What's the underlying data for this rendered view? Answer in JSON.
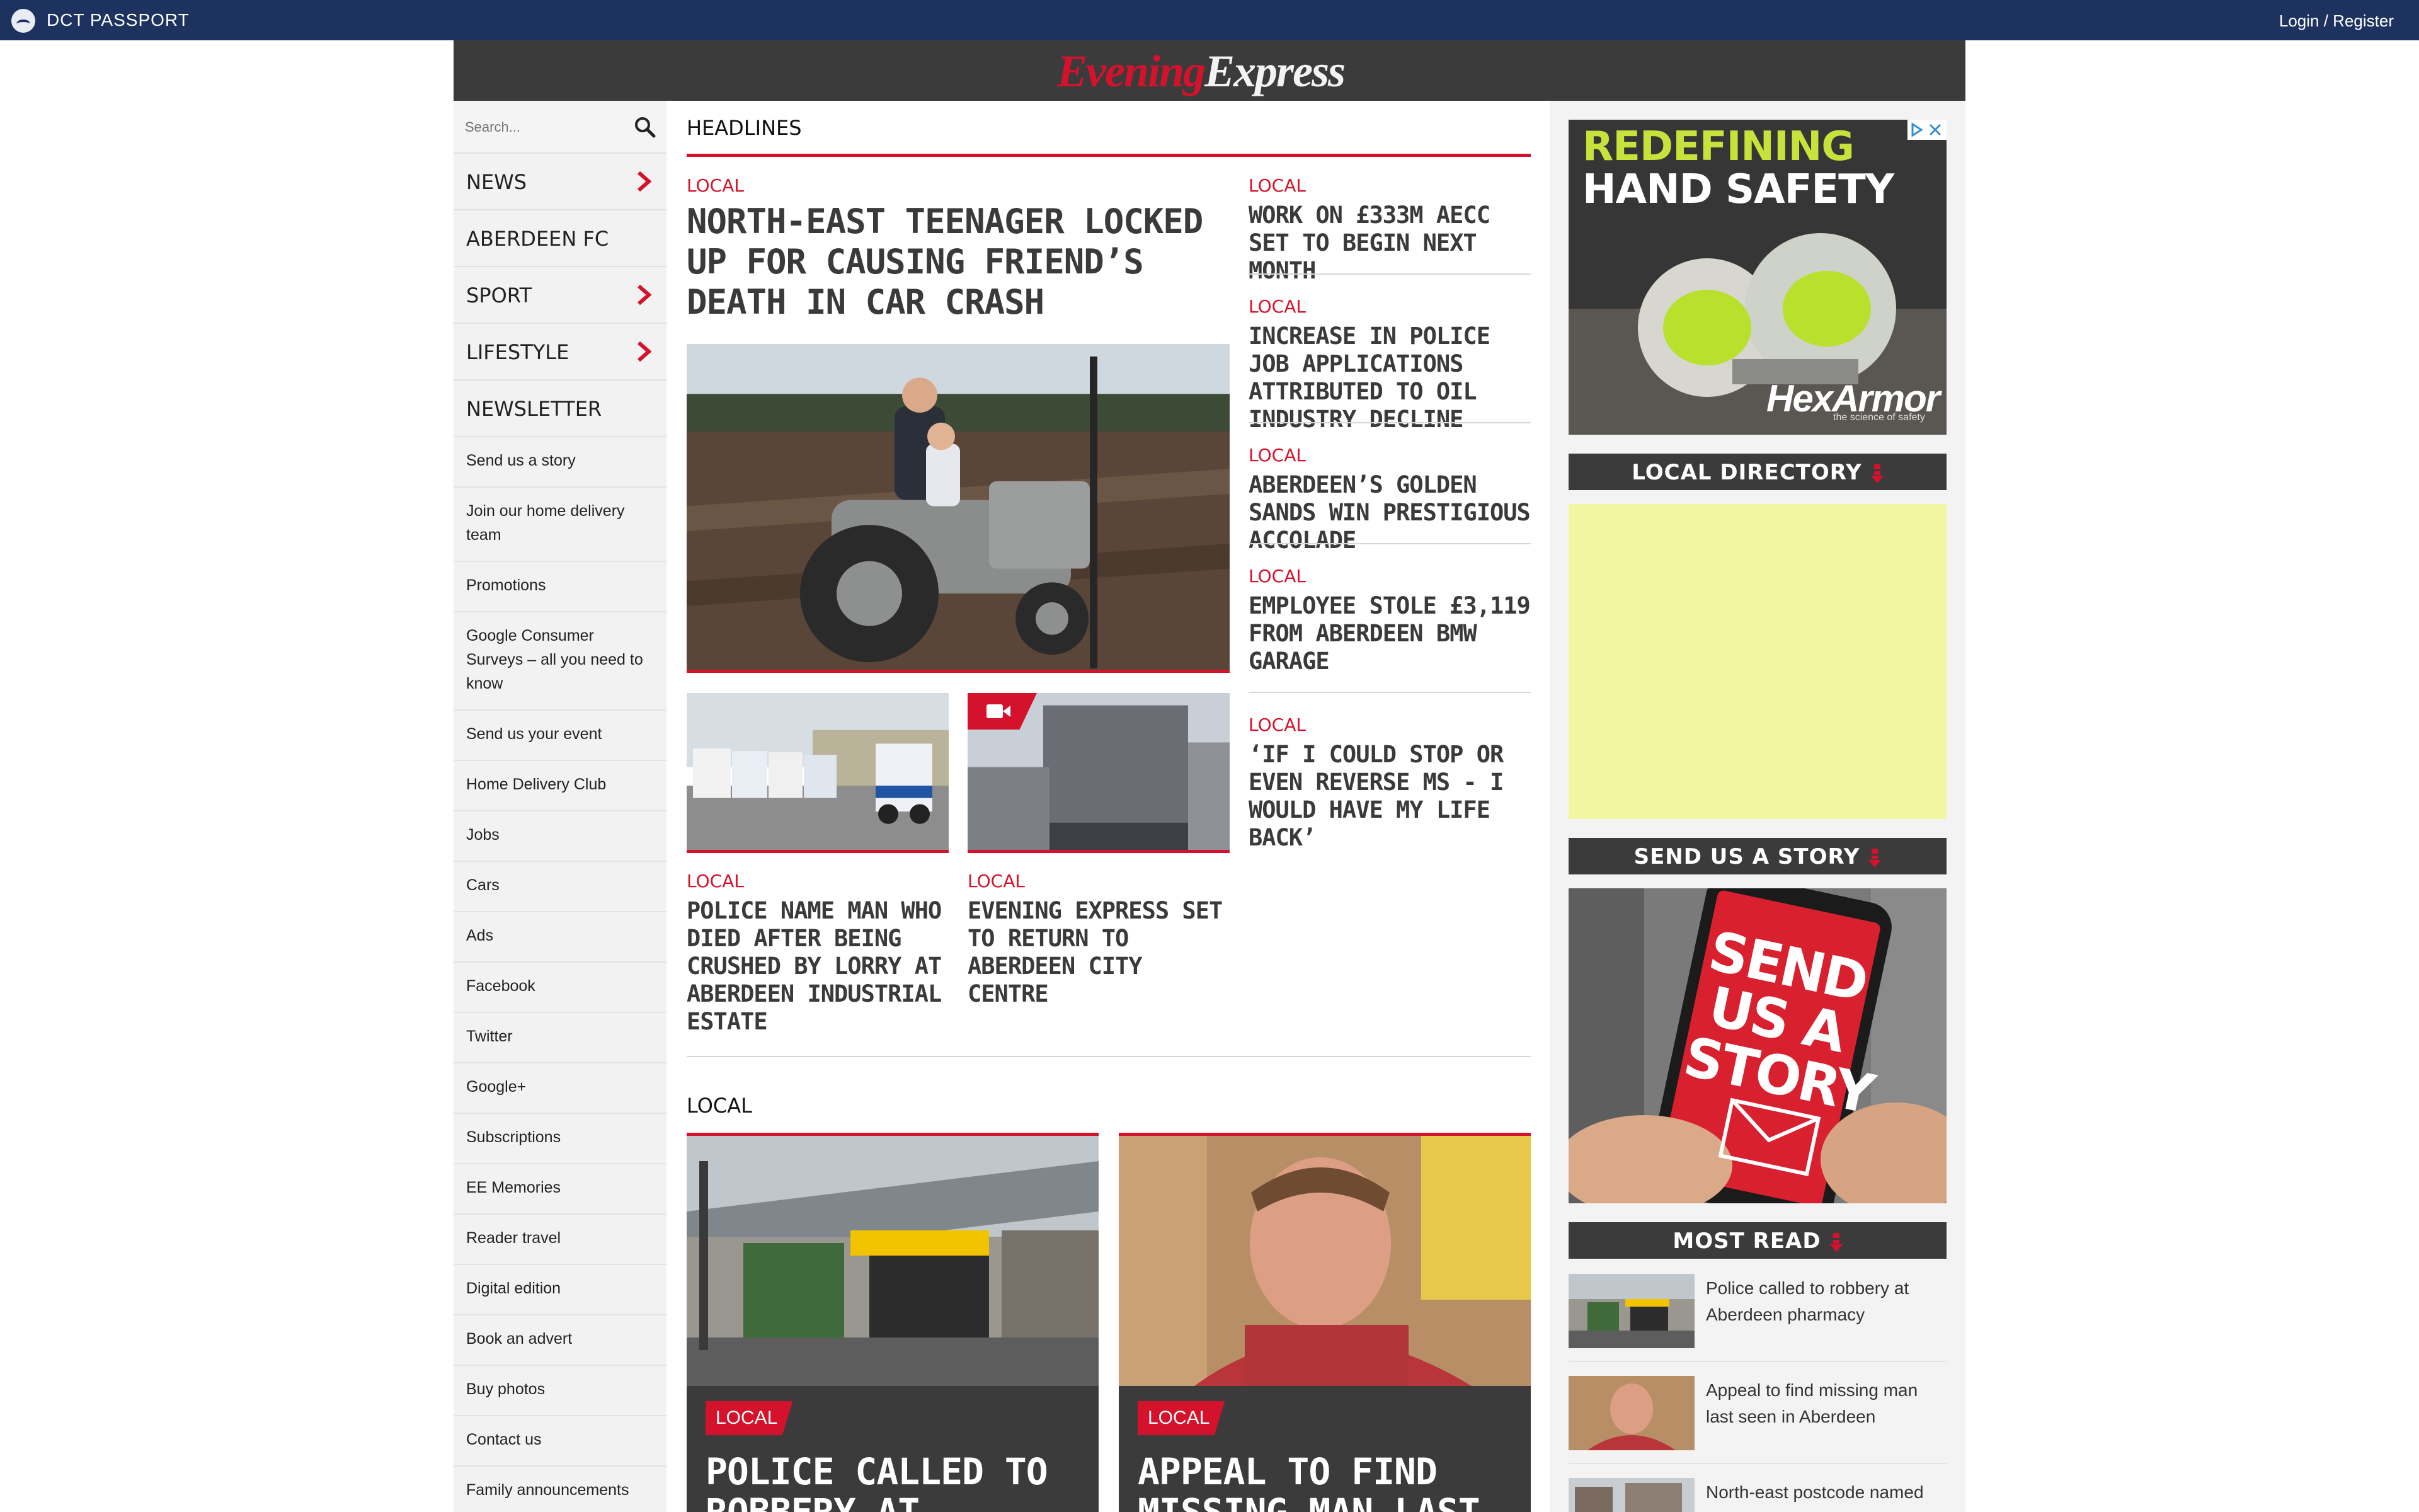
{
  "topbar": {
    "title": "DCT PASSPORT",
    "login": "Login / Register"
  },
  "brand": {
    "part1": "Evening",
    "part2": "Express",
    "colors": {
      "part1": "#d4122b",
      "part2": "#f3f3f3",
      "masthead_bg": "#3b3b3b"
    }
  },
  "sidebar": {
    "search_placeholder": "Search...",
    "main": [
      {
        "label": "NEWS",
        "has_chevron": true
      },
      {
        "label": "ABERDEEN FC",
        "has_chevron": false
      },
      {
        "label": "SPORT",
        "has_chevron": true
      },
      {
        "label": "LIFESTYLE",
        "has_chevron": true
      },
      {
        "label": "NEWSLETTER",
        "has_chevron": false
      }
    ],
    "links": [
      "Send us a story",
      "Join our home delivery team",
      "Promotions",
      "Google Consumer Surveys – all you need to know",
      "Send us your event",
      "Home Delivery Club",
      "Jobs",
      "Cars",
      "Ads",
      "Facebook",
      "Twitter",
      "Google+",
      "Subscriptions",
      "EE Memories",
      "Reader travel",
      "Digital edition",
      "Book an advert",
      "Buy photos",
      "Contact us",
      "Family announcements"
    ]
  },
  "headlines": {
    "title": "HEADLINES",
    "lead": {
      "category": "LOCAL",
      "title": "North-east teenager locked up for causing friend’s death in car crash"
    },
    "small": [
      {
        "category": "LOCAL",
        "title": "Police name man who died after being crushed by lorry at Aberdeen industrial estate"
      },
      {
        "category": "LOCAL",
        "title": "Evening Express set to return to Aberdeen city centre",
        "video": true
      }
    ],
    "side": [
      {
        "category": "LOCAL",
        "title": "Work on £333m AECC set to begin next month"
      },
      {
        "category": "LOCAL",
        "title": "Increase in police job applications attributed to oil industry decline"
      },
      {
        "category": "LOCAL",
        "title": "Aberdeen’s golden sands win prestigious accolade"
      },
      {
        "category": "LOCAL",
        "title": "Employee stole £3,119 from Aberdeen BMW garage"
      },
      {
        "category": "LOCAL",
        "title": "‘If I could stop or even reverse MS - I would have my life back’"
      }
    ]
  },
  "local": {
    "title": "LOCAL",
    "cards": [
      {
        "category": "LOCAL",
        "title": "Police called to robbery at Aberdeen pharmacy"
      },
      {
        "category": "LOCAL",
        "title": "Appeal to find missing man last seen in Aberdeen"
      }
    ]
  },
  "rail": {
    "ad": {
      "line1": "REDEFINING",
      "line2": "HAND SAFETY",
      "brand": "HexArmor",
      "tagline": "the science of safety"
    },
    "local_directory": "LOCAL DIRECTORY",
    "send_story_head": "SEND US A STORY",
    "send_story_image": {
      "line1": "SEND",
      "line2": "US A",
      "line3": "STORY"
    },
    "most_read_head": "MOST READ",
    "most_read": [
      "Police called to robbery at Aberdeen pharmacy",
      "Appeal to find missing man last seen in Aberdeen",
      "North-east postcode named"
    ]
  },
  "colors": {
    "accent": "#d4122b",
    "topbar": "#1e3260",
    "dark": "#3b3b3b"
  }
}
